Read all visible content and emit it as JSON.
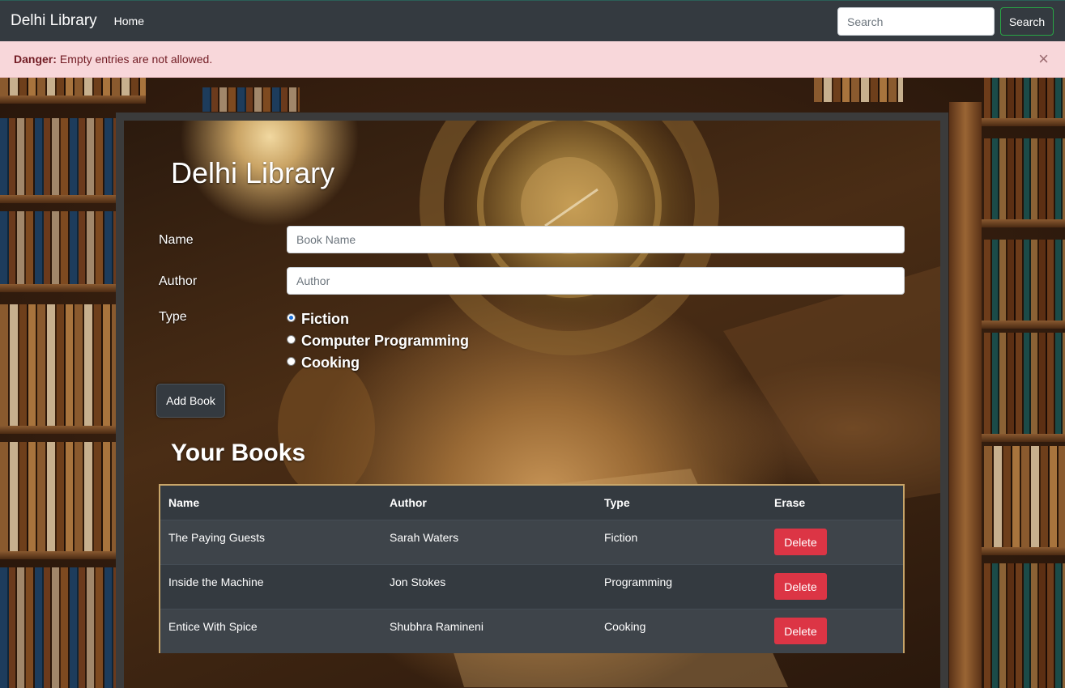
{
  "navbar": {
    "brand": "Delhi Library",
    "links": [
      "Home"
    ],
    "search_placeholder": "Search",
    "search_button": "Search"
  },
  "alert": {
    "label": "Danger:",
    "message": "Empty entries are not allowed.",
    "close": "×"
  },
  "app": {
    "title": "Delhi Library",
    "form": {
      "name_label": "Name",
      "name_placeholder": "Book Name",
      "author_label": "Author",
      "author_placeholder": "Author",
      "type_label": "Type",
      "types": [
        {
          "label": "Fiction",
          "checked": true
        },
        {
          "label": "Computer Programming",
          "checked": false
        },
        {
          "label": "Cooking",
          "checked": false
        }
      ],
      "add_button": "Add Book"
    },
    "books_title": "Your Books",
    "table": {
      "headers": [
        "Name",
        "Author",
        "Type",
        "Erase"
      ],
      "rows": [
        {
          "name": "The Paying Guests",
          "author": "Sarah Waters",
          "type": "Fiction",
          "action": "Delete"
        },
        {
          "name": "Inside the Machine",
          "author": "Jon Stokes",
          "type": "Programming",
          "action": "Delete"
        },
        {
          "name": "Entice With Spice",
          "author": "Shubhra Ramineni",
          "type": "Cooking",
          "action": "Delete"
        }
      ]
    }
  },
  "colors": {
    "navbar": "#343a40",
    "alert_bg": "#f8d7da",
    "alert_text": "#721c24",
    "search_button_border": "#28a745",
    "delete_button": "#dc3545",
    "table_border": "#c8a569"
  }
}
